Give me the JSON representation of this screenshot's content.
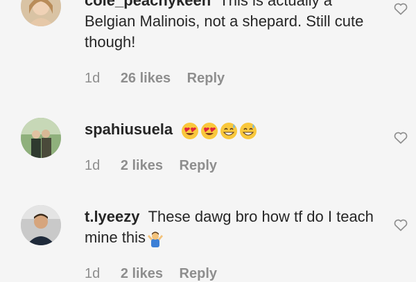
{
  "comments": [
    {
      "username": "cole_peachykeen",
      "text": "This is actually a Belgian Malinois, not a shepard. Still cute though!",
      "time": "1d",
      "likes": "26 likes",
      "reply": "Reply"
    },
    {
      "username": "spahiusuela",
      "text": "",
      "emojis": [
        "heart-eyes",
        "heart-eyes",
        "grinning-sweat",
        "grinning-sweat"
      ],
      "time": "1d",
      "likes": "2 likes",
      "reply": "Reply"
    },
    {
      "username": "t.lyeezy",
      "text": "These dawg bro how tf do I teach mine this",
      "emoji": "person-shrugging",
      "time": "1d",
      "likes": "2 likes",
      "reply": "Reply"
    }
  ],
  "icons": {
    "like": "heart-outline-icon"
  },
  "colors": {
    "background": "#f5f5f5",
    "text": "#262626",
    "muted": "#8e8e8e"
  }
}
